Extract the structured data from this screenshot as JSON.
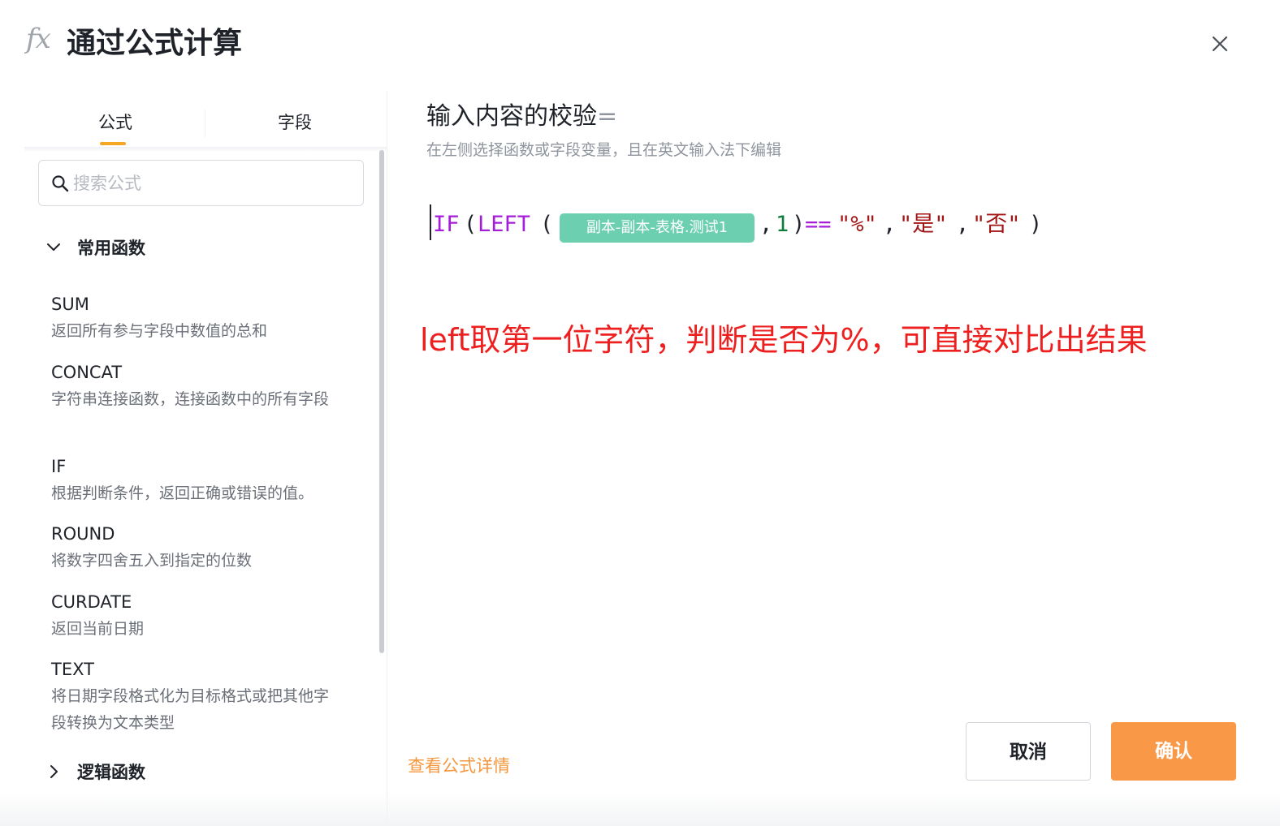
{
  "header": {
    "icon": "fx-icon",
    "title": "通过公式计算",
    "close_icon": "close-icon"
  },
  "left_panel": {
    "tabs": [
      {
        "label": "公式",
        "active": true
      },
      {
        "label": "字段",
        "active": false
      }
    ],
    "search": {
      "placeholder": "搜索公式",
      "value": ""
    },
    "groups": [
      {
        "label": "常用函数",
        "expanded": true,
        "items": [
          {
            "name": "SUM",
            "desc": "返回所有参与字段中数值的总和"
          },
          {
            "name": "CONCAT",
            "desc": "字符串连接函数，连接函数中的所有字段"
          },
          {
            "name": "IF",
            "desc": "根据判断条件，返回正确或错误的值。"
          },
          {
            "name": "ROUND",
            "desc": "将数字四舍五入到指定的位数"
          },
          {
            "name": "CURDATE",
            "desc": "返回当前日期"
          },
          {
            "name": "TEXT",
            "desc": "将日期字段格式化为目标格式或把其他字段转换为文本类型"
          }
        ]
      },
      {
        "label": "逻辑函数",
        "expanded": false
      }
    ]
  },
  "editor": {
    "heading": "输入内容的校验",
    "heading_eq": "=",
    "hint": "在左侧选择函数或字段变量，且在英文输入法下编辑",
    "tokens": {
      "fn_if": "IF",
      "p1": "(",
      "fn_left": "LEFT",
      "p2": "(",
      "field_chip": "副本-副本-表格.测试1",
      "comma1": ",",
      "num": "1",
      "p3": ")",
      "op": "==",
      "str1": "\"%\"",
      "comma2": ",",
      "str2": "\"是\"",
      "comma3": ",",
      "str3": "\"否\"",
      "p4": ")"
    }
  },
  "annotation": "left取第一位字符，判断是否为%，可直接对比出结果",
  "footer": {
    "details_link": "查看公式详情",
    "cancel_label": "取消",
    "confirm_label": "确认"
  },
  "colors": {
    "accent": "#f99947",
    "tab_underline": "#f5a623",
    "link": "#f5973f",
    "chip": "#6ccfb0",
    "annotation": "#ee1f1f",
    "token_function": "#a61dd9",
    "token_string": "#a31515",
    "token_number": "#0e7c3a"
  }
}
